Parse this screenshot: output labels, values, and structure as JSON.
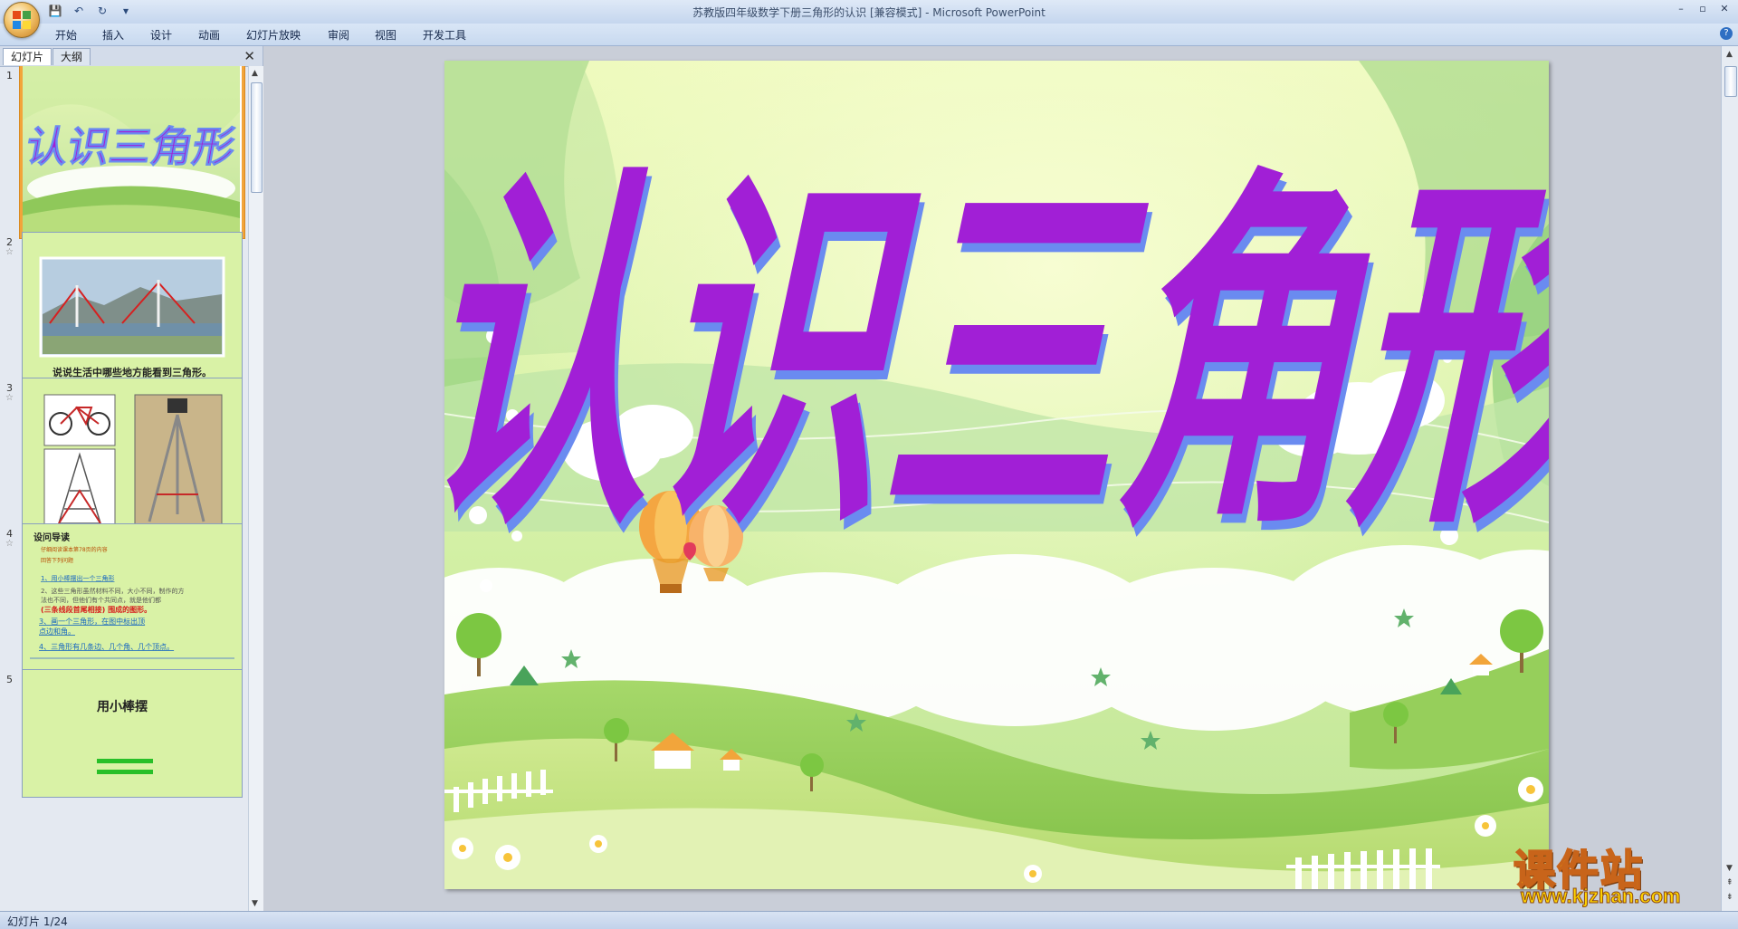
{
  "window": {
    "title": "苏教版四年级数学下册三角形的认识 [兼容模式] - Microsoft PowerPoint",
    "controls": {
      "minimize": "–",
      "maximize": "▫",
      "close": "✕"
    }
  },
  "quick_access": {
    "save": "💾",
    "undo": "↶",
    "redo": "↻",
    "customize": "▾"
  },
  "ribbon": {
    "tabs": [
      "开始",
      "插入",
      "设计",
      "动画",
      "幻灯片放映",
      "审阅",
      "视图",
      "开发工具"
    ],
    "help": "?"
  },
  "panel": {
    "tabs": {
      "slides": "幻灯片",
      "outline": "大纲"
    },
    "close": "✕"
  },
  "thumbnails": [
    {
      "num": "1",
      "title": "认识三角形"
    },
    {
      "num": "2",
      "star": "☆",
      "caption": "说说生活中哪些地方能看到三角形。"
    },
    {
      "num": "3",
      "star": "☆"
    },
    {
      "num": "4",
      "star": "☆",
      "heading": "设问导读",
      "lines": [
        "仔细阅读课本第78页的内容",
        "回答下列问题",
        "1、用小棒摆出一个三角形",
        "2、这些三角形虽然材料不同，大小不同，制作的方",
        "法也不同，但他们有个共同点，就是他们都",
        "(三条线段首尾相接) 围成的图形。",
        "3、画一个三角形，在图中标出顶",
        "点边和角。",
        "4、三角形有几条边、几个角、几个顶点。"
      ]
    },
    {
      "num": "5",
      "heading": "用小棒摆"
    }
  ],
  "slide": {
    "title": "认识三角形"
  },
  "status": {
    "slide_position": "幻灯片 1/24"
  },
  "watermark": {
    "big": "课件站",
    "small": "www.kjzhan.com"
  },
  "colors": {
    "accent": "#f2a43a",
    "title_purple": "#a11fd6",
    "title_shadow": "#6a8bf0"
  }
}
